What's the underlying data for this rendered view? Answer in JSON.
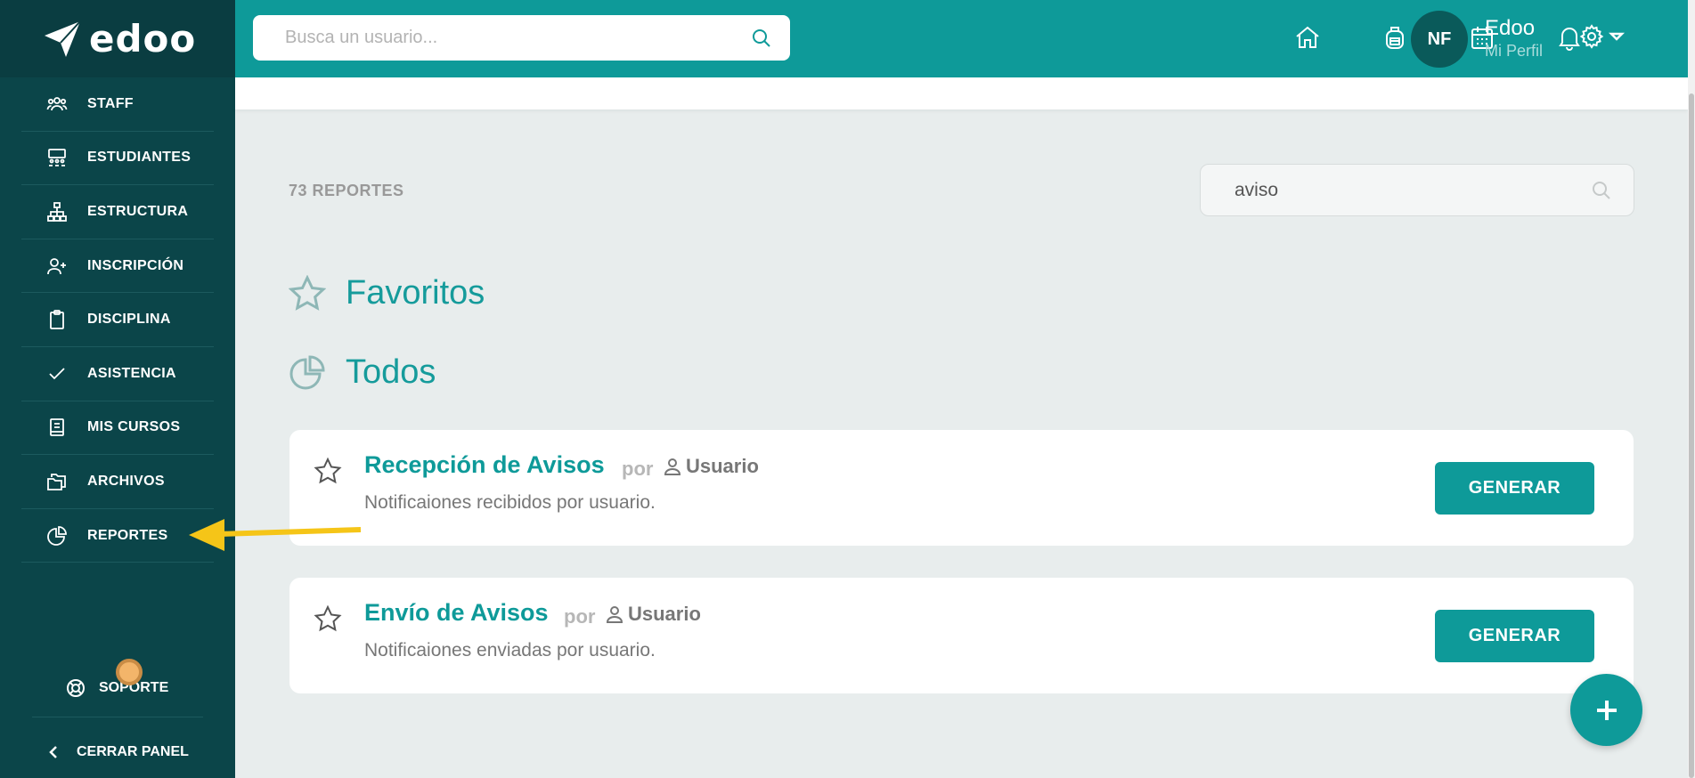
{
  "brand": {
    "name": "edoo"
  },
  "sidebar": {
    "items": [
      {
        "label": "STAFF",
        "icon": "users-icon"
      },
      {
        "label": "ESTUDIANTES",
        "icon": "classroom-icon"
      },
      {
        "label": "ESTRUCTURA",
        "icon": "hierarchy-icon"
      },
      {
        "label": "INSCRIPCIÓN",
        "icon": "add-user-icon"
      },
      {
        "label": "DISCIPLINA",
        "icon": "clipboard-icon"
      },
      {
        "label": "ASISTENCIA",
        "icon": "check-icon"
      },
      {
        "label": "MIS CURSOS",
        "icon": "book-icon"
      },
      {
        "label": "ARCHIVOS",
        "icon": "folders-icon"
      },
      {
        "label": "REPORTES",
        "icon": "pie-chart-icon",
        "active": true
      }
    ],
    "support_label": "SOPORTE",
    "collapse_label": "CERRAR PANEL"
  },
  "header": {
    "search_placeholder": "Busca un usuario...",
    "icons": [
      "home-icon",
      "backpack-icon",
      "calendar-icon",
      "bell-icon"
    ],
    "avatar_initials": "NF",
    "profile_name": "Edoo",
    "profile_sub": "Mi Perfil"
  },
  "main": {
    "count_label": "73 REPORTES",
    "filter_value": "aviso",
    "favorites_title": "Favoritos",
    "all_title": "Todos",
    "reports": [
      {
        "title": "Recepción de Avisos",
        "by": "por",
        "user": "Usuario",
        "description": "Notificaiones recibidos por usuario.",
        "button": "GENERAR"
      },
      {
        "title": "Envío de Avisos",
        "by": "por",
        "user": "Usuario",
        "description": "Notificaiones enviadas por usuario.",
        "button": "GENERAR"
      }
    ]
  },
  "colors": {
    "teal": "#0e9a99",
    "sidebar": "#0b4549",
    "annotation_arrow": "#f5c518"
  }
}
